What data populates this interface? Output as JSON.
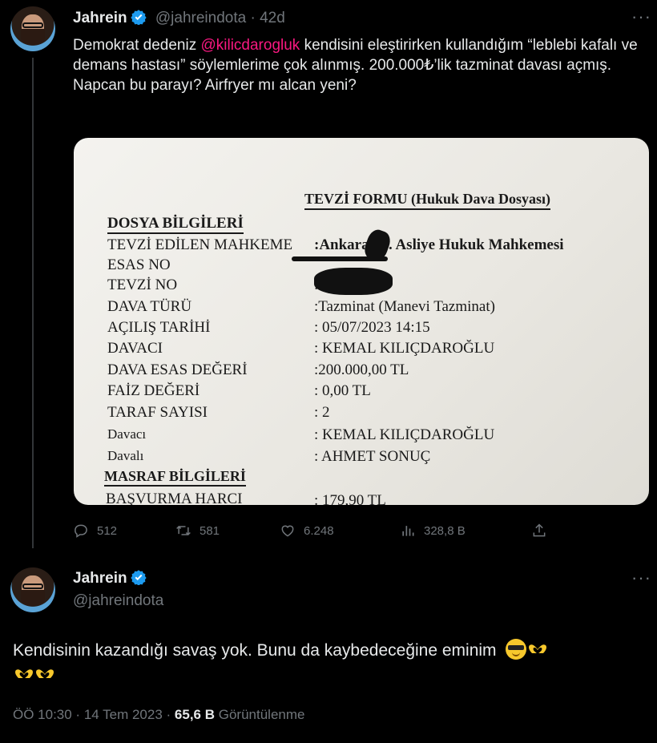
{
  "tweet1": {
    "author_name": "Jahrein",
    "handle": "@jahreindota",
    "age": "42d",
    "text_pre": "Demokrat dedeniz ",
    "mention": "@kilicdarogluk",
    "text_post": " kendisini eleştirirken kullandığım “leblebi kafalı ve demans hastası” söylemlerime çok alınmış. 200.000₺’lik tazminat davası açmış.",
    "text_line2": "Napcan bu parayı? Airfryer mı alcan yeni?",
    "document": {
      "title": "TEVZİ FORMU (Hukuk Dava Dosyası)",
      "section1": "DOSYA BİLGİLERİ",
      "rows": [
        {
          "label": "TEVZİ EDİLEN MAHKEME",
          "value": ":Ankara",
          "value2": ". Asliye Hukuk Mahkemesi"
        },
        {
          "label": "ESAS NO",
          "value": ""
        },
        {
          "label": "TEVZİ NO",
          "value": ":"
        },
        {
          "label": "DAVA TÜRÜ",
          "value": ":Tazminat (Manevi Tazminat)"
        },
        {
          "label": "AÇILIŞ TARİHİ",
          "value": ": 05/07/2023  14:15"
        },
        {
          "label": "DAVACI",
          "value": ": KEMAL KILIÇDAROĞLU"
        },
        {
          "label": "DAVA ESAS DEĞERİ",
          "value": ":200.000,00 TL"
        },
        {
          "label": "FAİZ DEĞERİ",
          "value": ": 0,00 TL"
        },
        {
          "label": "TARAF SAYISI",
          "value": ": 2"
        },
        {
          "label": "Davacı",
          "value": ": KEMAL KILIÇDAROĞLU"
        },
        {
          "label": "Davalı",
          "value": ": AHMET SONUÇ"
        }
      ],
      "section2": "MASRAF BİLGİLERİ",
      "last_label": "BAŞVURMA HARCI",
      "last_value": ": 179,90 TL"
    },
    "actions": {
      "replies": "512",
      "retweets": "581",
      "likes": "6.248",
      "views": "328,8 B"
    }
  },
  "tweet2": {
    "author_name": "Jahrein",
    "handle": "@jahreindota",
    "text": "Kendisinin kazandığı savaş yok. Bunu da kaybedeceğine eminim",
    "time": "ÖÖ 10:30 · 14 Tem 2023 · ",
    "views_count": "65,6 B",
    "views_label": " Görüntülenme"
  },
  "colors": {
    "background": "#000000",
    "text": "#e7e9ea",
    "muted": "#71767b",
    "mention": "#f91880",
    "verified": "#1d9bf0"
  },
  "icons": [
    "more-icon",
    "verified-badge-icon",
    "reply-icon",
    "retweet-icon",
    "like-icon",
    "views-icon",
    "share-icon",
    "sunglasses-emoji-icon",
    "heart-hands-emoji-icon"
  ]
}
